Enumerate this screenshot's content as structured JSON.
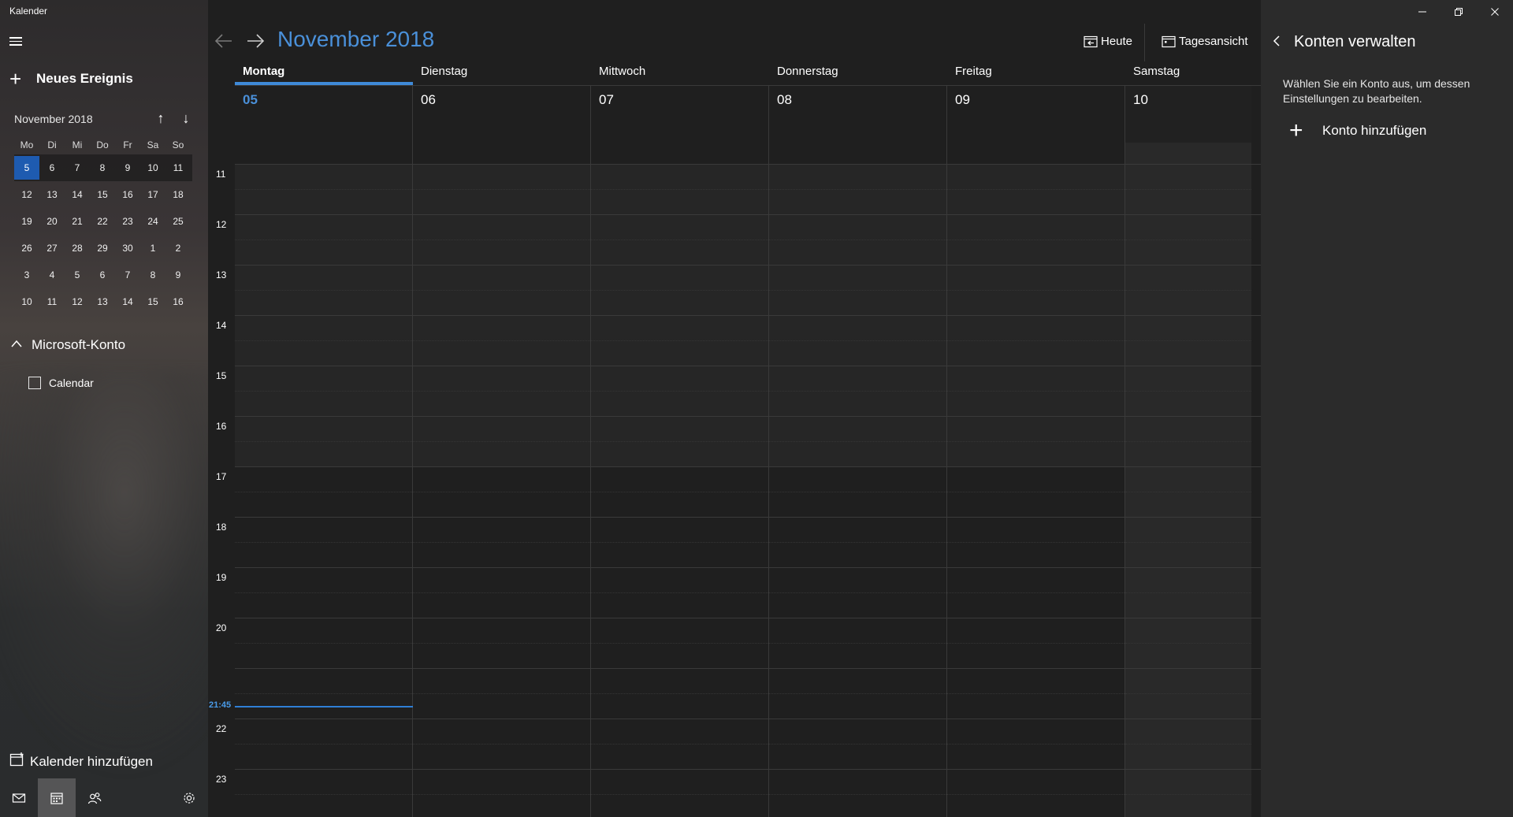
{
  "app": {
    "title": "Kalender"
  },
  "sidebar": {
    "new_event_label": "Neues Ereignis",
    "mini_calendar": {
      "month": "November 2018",
      "weekdays": [
        "Mo",
        "Di",
        "Mi",
        "Do",
        "Fr",
        "Sa",
        "So"
      ],
      "weeks": [
        [
          "5",
          "6",
          "7",
          "8",
          "9",
          "10",
          "11"
        ],
        [
          "12",
          "13",
          "14",
          "15",
          "16",
          "17",
          "18"
        ],
        [
          "19",
          "20",
          "21",
          "22",
          "23",
          "24",
          "25"
        ],
        [
          "26",
          "27",
          "28",
          "29",
          "30",
          "1",
          "2"
        ],
        [
          "3",
          "4",
          "5",
          "6",
          "7",
          "8",
          "9"
        ],
        [
          "10",
          "11",
          "12",
          "13",
          "14",
          "15",
          "16"
        ]
      ],
      "today": "5"
    },
    "account_group": "Microsoft-Konto",
    "calendars": [
      {
        "label": "Calendar",
        "checked": false
      }
    ],
    "add_calendar_label": "Kalender hinzufügen",
    "bottom_icons": [
      "mail-icon",
      "calendar-icon",
      "people-icon",
      "settings-icon"
    ]
  },
  "main": {
    "month_title": "November 2018",
    "today_button": "Heute",
    "view_button": "Tagesansicht",
    "days": [
      {
        "name": "Montag",
        "date": "05",
        "selected": true
      },
      {
        "name": "Dienstag",
        "date": "06",
        "selected": false
      },
      {
        "name": "Mittwoch",
        "date": "07",
        "selected": false
      },
      {
        "name": "Donnerstag",
        "date": "08",
        "selected": false
      },
      {
        "name": "Freitag",
        "date": "09",
        "selected": false
      },
      {
        "name": "Samstag",
        "date": "10",
        "selected": false
      }
    ],
    "hours": [
      "11",
      "12",
      "13",
      "14",
      "15",
      "16",
      "17",
      "18",
      "19",
      "20",
      "",
      "22",
      "23"
    ],
    "current_time": "21:45",
    "accent_color": "#4a90d9"
  },
  "panel": {
    "title": "Konten verwalten",
    "description": "Wählen Sie ein Konto aus, um dessen Einstellungen zu bearbeiten.",
    "add_account_label": "Konto hinzufügen"
  }
}
